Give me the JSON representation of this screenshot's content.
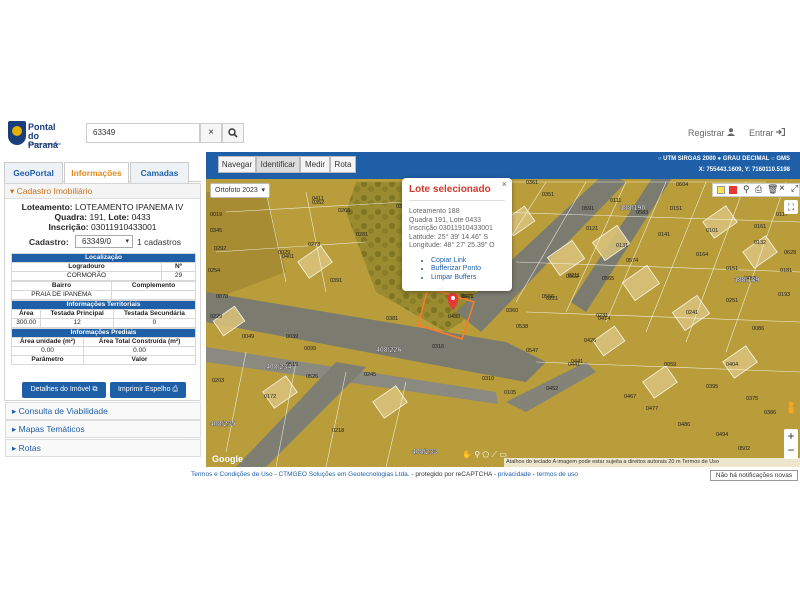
{
  "header": {
    "logo_line1": "Pontal",
    "logo_line2": "do Paraná",
    "logo_sub": "governo municipal",
    "search_value": "63349",
    "clear_icon": "×",
    "search_icon": "⚲",
    "register_label": "Registrar",
    "login_label": "Entrar"
  },
  "left_tabs": [
    {
      "label": "GeoPortal"
    },
    {
      "label": "Informações"
    },
    {
      "label": "Camadas"
    }
  ],
  "cadastro": {
    "section_title": "Cadastro Imobiliário",
    "loteamento_label": "Loteamento:",
    "loteamento_value": "LOTEAMENTO IPANEMA IV",
    "quadra_label": "Quadra:",
    "quadra_value": "191",
    "lote_label": "Lote:",
    "lote_value": "0433",
    "inscricao_label": "Inscrição:",
    "inscricao_value": "03011910433001",
    "cadastro_label": "Cadastro:",
    "cadastro_select": "63349/0",
    "cadastro_count": "1 cadastros"
  },
  "localizacao": {
    "header": "Localização",
    "logradouro_label": "Logradouro",
    "numero_label": "Nº",
    "logradouro_value": "CORMORÃO",
    "numero_value": "29",
    "bairro_label": "Bairro",
    "complemento_label": "Complemento",
    "bairro_value": "PRAIA DE IPANEMA",
    "complemento_value": ""
  },
  "territoriais": {
    "header": "Informações Territoriais",
    "cols": [
      "Área",
      "Testada Principal",
      "Testada Secundária"
    ],
    "vals": [
      "300.00",
      "12",
      "0"
    ]
  },
  "prediais": {
    "header": "Informações Prediais",
    "cols": [
      "Área unidade (m²)",
      "Área Total Construída (m²)"
    ],
    "vals": [
      "0.00",
      "0.00"
    ],
    "cols2": [
      "Parâmetro",
      "Valor"
    ]
  },
  "buttons": {
    "detalhes": "Detalhes do Imóvel",
    "imprimir": "Imprimir Espelho"
  },
  "accordion": [
    {
      "label": "Consulta de Viabilidade"
    },
    {
      "label": "Mapas Temáticos"
    },
    {
      "label": "Rotas"
    }
  ],
  "map_toolbar": {
    "tools": [
      "Navegar",
      "Identificar",
      "Medir",
      "Rota"
    ],
    "coord_options": [
      "UTM SIRGAS 2000",
      "GRAU DECIMAL",
      "GMS"
    ],
    "coord_readout": "X: 755443.1609, Y: 7160110.5198",
    "basemap": "Ortofoto 2023"
  },
  "popup": {
    "title": "Lote selecionado",
    "lines": [
      "Loteamento 188",
      "Quadra 191, Lote 0433",
      "Inscrição 03011910433001",
      "Latitude: 25° 39' 14.46\" S",
      "Longitude: 48° 27' 25.39\" O"
    ],
    "links": [
      "Copiar Link",
      "Bufferizar Ponto",
      "Limpar Buffers"
    ]
  },
  "map_labels": {
    "lot_numbers": [
      "0361",
      "0351",
      "0111",
      "0121",
      "0131",
      "0141",
      "0151",
      "0161",
      "0101",
      "0211",
      "0221",
      "0231",
      "0241",
      "0251",
      "0371",
      "0381",
      "0391",
      "0401",
      "0411",
      "0421",
      "0433",
      "0441",
      "0450",
      "0019",
      "0029",
      "0039",
      "0049",
      "0059",
      "0069",
      "0078",
      "0086",
      "0099",
      "0105",
      "0117",
      "0132",
      "0151",
      "0164",
      "0172",
      "0181",
      "0193",
      "0203",
      "0218",
      "0229",
      "0245",
      "0254",
      "0266",
      "0273",
      "0281",
      "0292",
      "0310",
      "0316",
      "0329",
      "0345",
      "0352",
      "0360",
      "0375",
      "0386",
      "0395",
      "0404",
      "0414",
      "0426",
      "0441",
      "0452",
      "0467",
      "0477",
      "0486",
      "0494",
      "0502",
      "0515",
      "0526",
      "0538",
      "0547",
      "0556",
      "0565",
      "0574",
      "0583",
      "0591",
      "0604",
      "0613",
      "0628"
    ],
    "block_labels": [
      "188/190",
      "188/189",
      "408/234",
      "408/235",
      "408/233",
      "408/226"
    ],
    "attribution_left": "Google",
    "attribution_right": "Atalhos do teclado  A imagem pode estar sujeita a direitos autorais  20 m  Termos de Uso"
  },
  "footer": {
    "terms": "Termos e Condições de Uso",
    "company": "CTMGEO Soluções em Geotecnologias Ltda.",
    "protected": "protegido por reCAPTCHA",
    "privacy": "privacidade",
    "terms2": "termos de uso",
    "notifications": "Não há notificações novas"
  }
}
